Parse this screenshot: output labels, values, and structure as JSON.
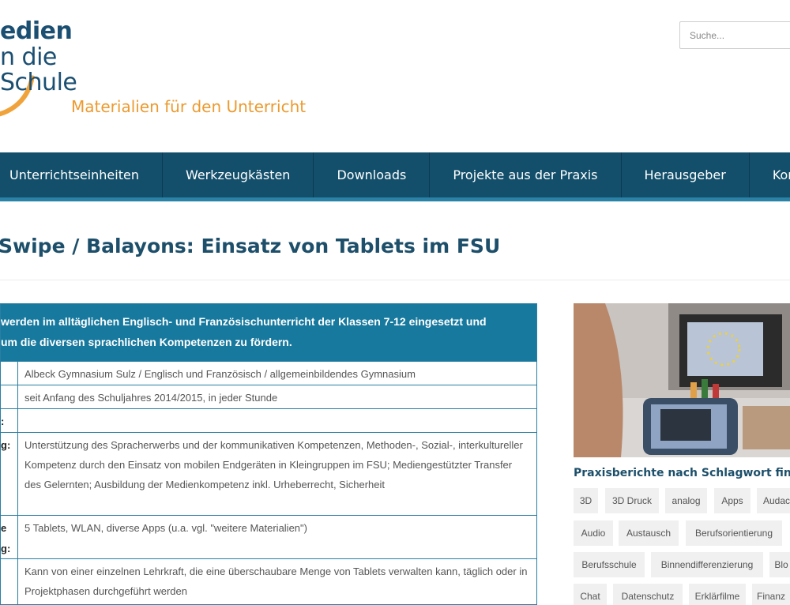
{
  "logo": {
    "line1": "edien",
    "line2": "n die",
    "line3": "Schule",
    "tagline": "Materialien für den Unterricht"
  },
  "search": {
    "placeholder": "Suche..."
  },
  "nav": {
    "items": [
      "Unterrichtseinheiten",
      "Werkzeugkästen",
      "Downloads",
      "Projekte aus der Praxis",
      "Herausgeber",
      "Kon"
    ]
  },
  "page": {
    "title": "Swipe / Balayons: Einsatz von Tablets im FSU"
  },
  "info_table": {
    "header_line1": "werden im alltäglichen Englisch- und Französischunterricht der Klassen 7-12 eingesetzt und",
    "header_line2": "um die diversen sprachlichen Kompetenzen zu fördern.",
    "rows": [
      {
        "key": "",
        "value": "Albeck Gymnasium Sulz / Englisch und Französisch / allgemeinbildendes Gymnasium"
      },
      {
        "key": "",
        "value": "seit Anfang des Schuljahres 2014/2015, in jeder Stunde"
      },
      {
        "key": ":",
        "value": ""
      },
      {
        "key": "g:",
        "value": "Unterstützung des Spracherwerbs und der kommunikativen Kompetenzen, Methoden-, Sozial-, interkultureller Kompetenz durch den Einsatz von mobilen Endgeräten in Kleingruppen im FSU; Mediengestützter Transfer des Gelernten; Ausbildung der Medienkompetenz inkl. Urheberrecht, Sicherheit"
      },
      {
        "key": "e",
        "key2": "g:",
        "value": "5 Tablets, WLAN, diverse Apps (u.a. vgl. \"weitere Materialien\")"
      },
      {
        "key": "",
        "value": "Kann von einer einzelnen Lehrkraft, die eine überschaubare Menge von Tablets verwalten kann, täglich oder in Projektphasen durchgeführt werden"
      }
    ]
  },
  "sidebar": {
    "title": "Praxisberichte nach Schlagwort finde",
    "tags": [
      "3D",
      "3D Druck",
      "analog",
      "Apps",
      "Audac",
      "Audio",
      "Austausch",
      "Berufsorientierung",
      "Berufsschule",
      "Binnendifferenzierung",
      "Blo",
      "Chat",
      "Datenschutz",
      "Erklärfilme",
      "Finanz"
    ]
  },
  "colors": {
    "nav_bg": "#134f6b",
    "accent": "#17799e",
    "title": "#1d4f6a",
    "orange": "#ec9a2f"
  }
}
